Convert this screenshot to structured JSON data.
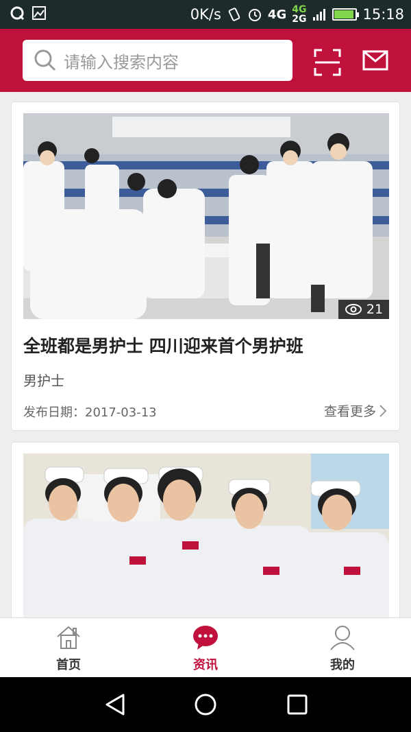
{
  "status_bar": {
    "speed": "0K/s",
    "network_top": "4G",
    "network_bottom": "2G",
    "network_label": "4G",
    "time": "15:18"
  },
  "header": {
    "search_placeholder": "请输入搜索内容"
  },
  "articles": [
    {
      "title": "全班都是男护士 四川迎来首个男护班",
      "tag": "男护士",
      "date_label": "发布日期：",
      "date": "2017-03-13",
      "views": "21",
      "more_label": "查看更多"
    },
    {
      "title": "",
      "tag": ""
    }
  ],
  "bottom_nav": {
    "items": [
      {
        "label": "首页",
        "icon": "home-icon"
      },
      {
        "label": "资讯",
        "icon": "chat-bubble-icon",
        "active": true
      },
      {
        "label": "我的",
        "icon": "user-icon"
      }
    ]
  },
  "colors": {
    "brand": "#c0113c",
    "status_bar": "#1d2b2b",
    "background": "#eeeeee"
  }
}
